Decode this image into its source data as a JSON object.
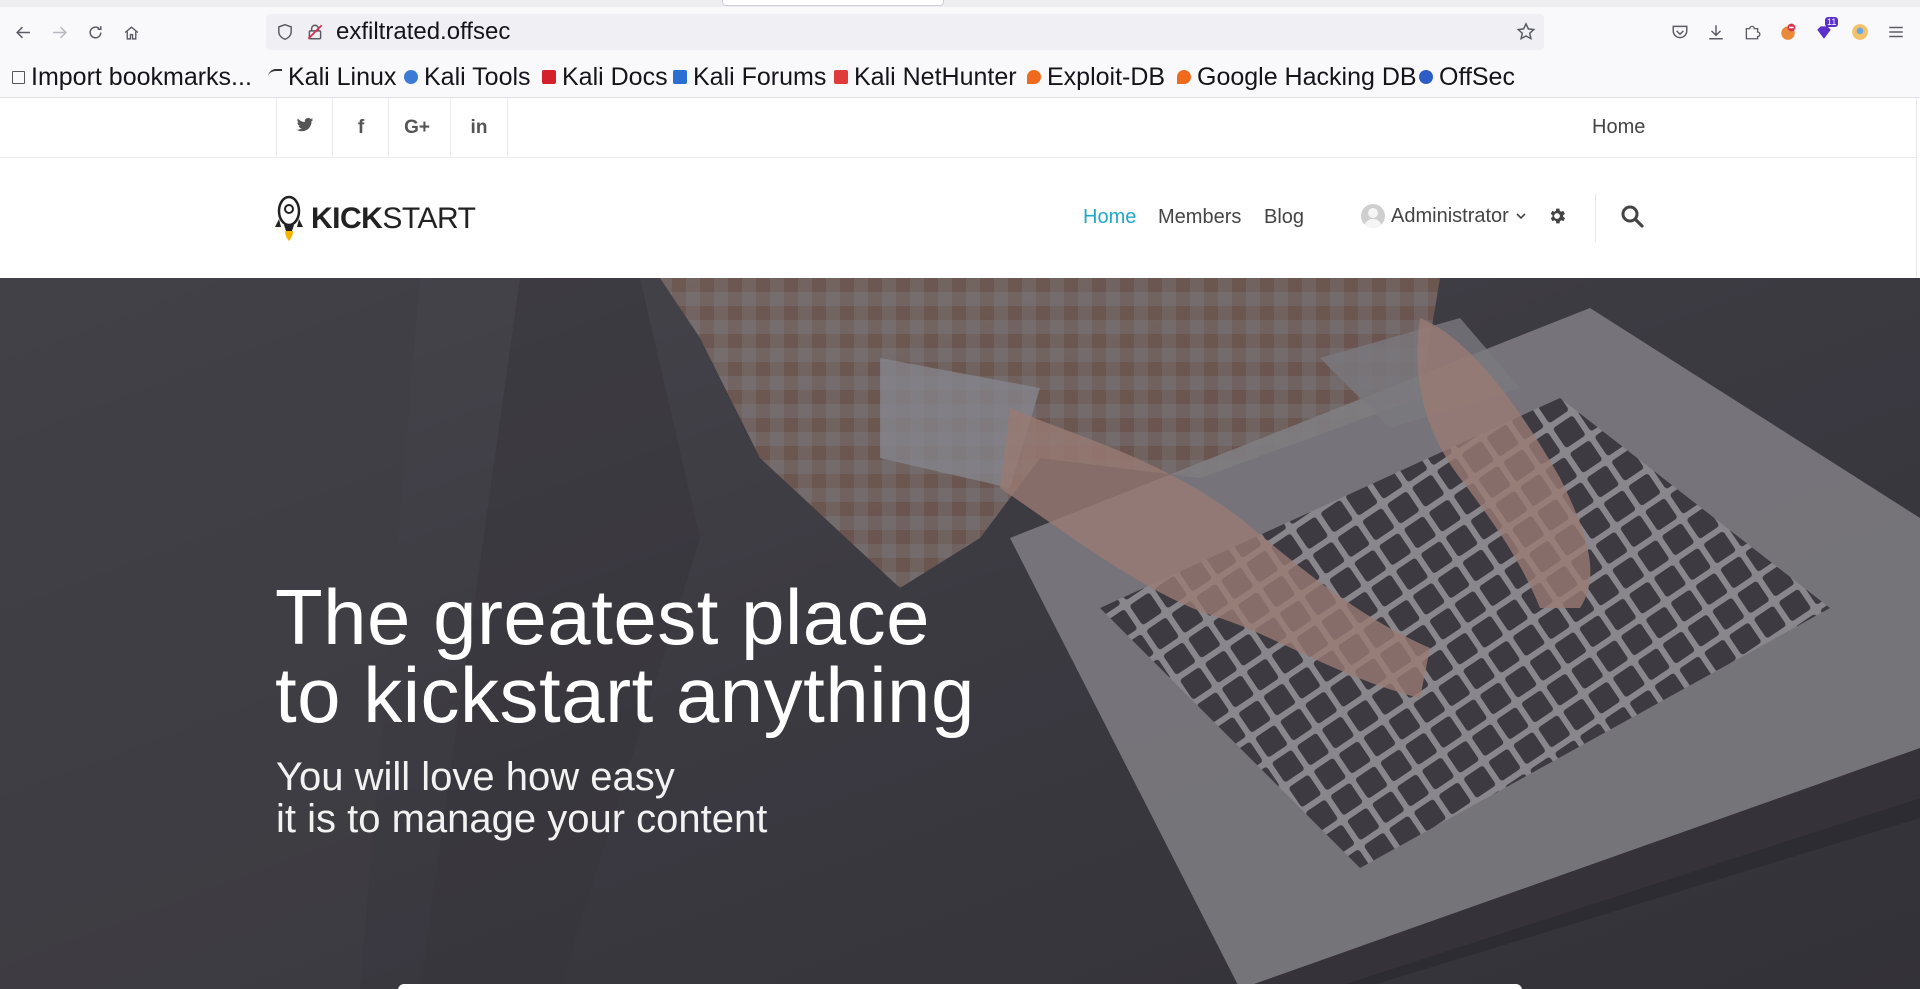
{
  "browser": {
    "url": "exfiltrated.offsec",
    "bookmarks": [
      {
        "label": "Import bookmarks...",
        "icon": "import-icon"
      },
      {
        "label": "Kali Linux",
        "icon": "kali-icon"
      },
      {
        "label": "Kali Tools",
        "icon": "kali-tools-icon"
      },
      {
        "label": "Kali Docs",
        "icon": "kali-docs-icon"
      },
      {
        "label": "Kali Forums",
        "icon": "kali-forums-icon"
      },
      {
        "label": "Kali NetHunter",
        "icon": "nethunter-icon"
      },
      {
        "label": "Exploit-DB",
        "icon": "exploitdb-icon"
      },
      {
        "label": "Google Hacking DB",
        "icon": "ghdb-icon"
      },
      {
        "label": "OffSec",
        "icon": "offsec-icon"
      }
    ],
    "extension_badge": "11"
  },
  "site": {
    "social": [
      "twitter-icon",
      "facebook-icon",
      "google-plus-icon",
      "linkedin-icon"
    ],
    "social_glyphs": [
      "🐦",
      "f",
      "G+",
      "in"
    ],
    "top_nav_home": "Home",
    "logo": {
      "bold": "KICK",
      "regular": "START"
    },
    "menu": {
      "home": "Home",
      "members": "Members",
      "blog": "Blog"
    },
    "user": "Administrator",
    "accent_color": "#1fa9c9"
  },
  "hero": {
    "title_line1": "The greatest place",
    "title_line2": "to kickstart anything",
    "subtitle_line1": "You will love how easy",
    "subtitle_line2": "it is to manage your content"
  }
}
